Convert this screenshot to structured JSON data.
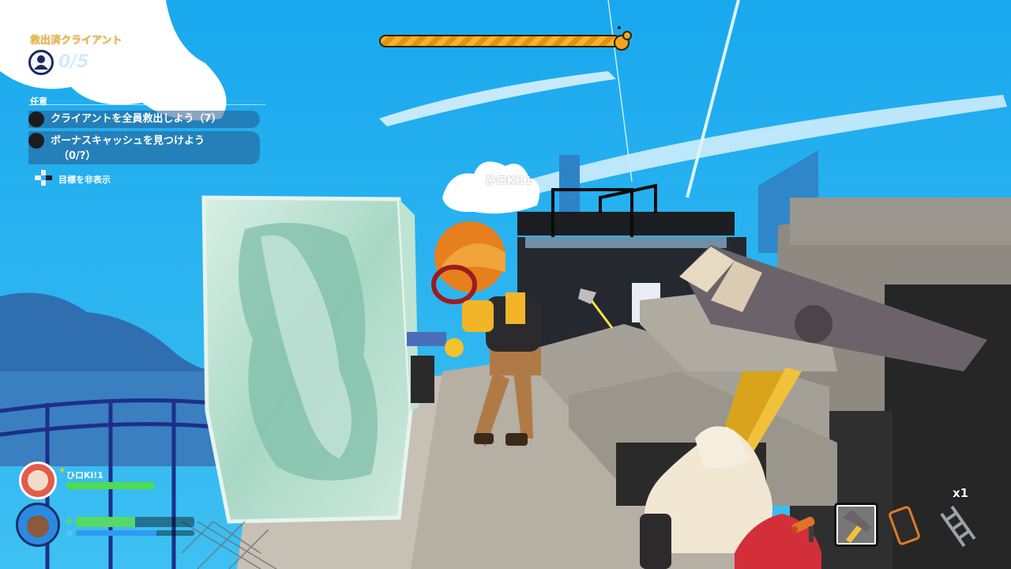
{
  "hud": {
    "rescued_label": "救出済クライアント",
    "rescued_count": "0/5",
    "optional_label": "任意",
    "objectives": [
      {
        "text": "クライアントを全員救出しよう（7）"
      },
      {
        "text": "ボーナスキャッシュを見つけよう",
        "subtext": "（0/?）"
      }
    ],
    "hide_objectives": "目標を非表示",
    "timer_fraction": 1.0
  },
  "teammate_label": "ひロKi!1",
  "party": {
    "player1": {
      "name": "ひロKi!1",
      "health_fraction": 1.0
    },
    "player2": {
      "health_fraction": 0.5,
      "water_fraction": 0.68
    }
  },
  "inventory": {
    "slots": [
      {
        "item": "extinguisher-icon",
        "selected": false
      },
      {
        "item": "axe-icon",
        "selected": true
      },
      {
        "item": "phone-icon",
        "selected": false
      },
      {
        "item": "ladder-icon",
        "selected": false,
        "count": "x1"
      }
    ]
  },
  "colors": {
    "sky": "#1aa6e8",
    "timer_fill": "#f8b423",
    "rescued_label": "#f2b233",
    "health": "#4fdc50",
    "water": "#2e9bf0"
  }
}
